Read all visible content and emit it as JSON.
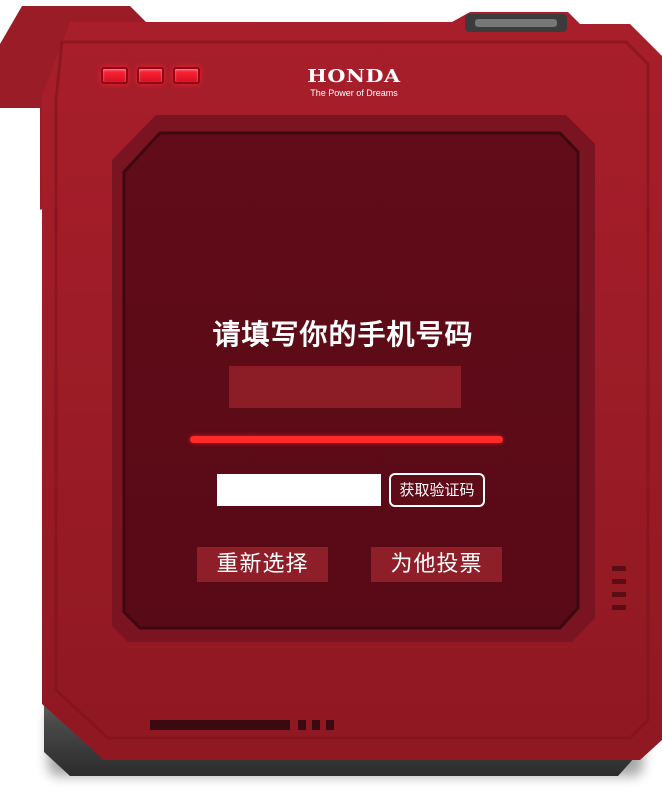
{
  "brand": {
    "logo": "HONDA",
    "tagline": "The Power of Dreams"
  },
  "form": {
    "title": "请填写你的手机号码",
    "phone_value": "",
    "code_value": "",
    "code_placeholder": "",
    "get_code_label": "获取验证码"
  },
  "actions": {
    "reselect_label": "重新选择",
    "vote_label": "为他投票"
  },
  "colors": {
    "frame": "#9b1c26",
    "screen": "#5e0c18",
    "accent_bar": "#ff2a2a",
    "field": "#8c1d27",
    "led": "#ff2a3a"
  }
}
